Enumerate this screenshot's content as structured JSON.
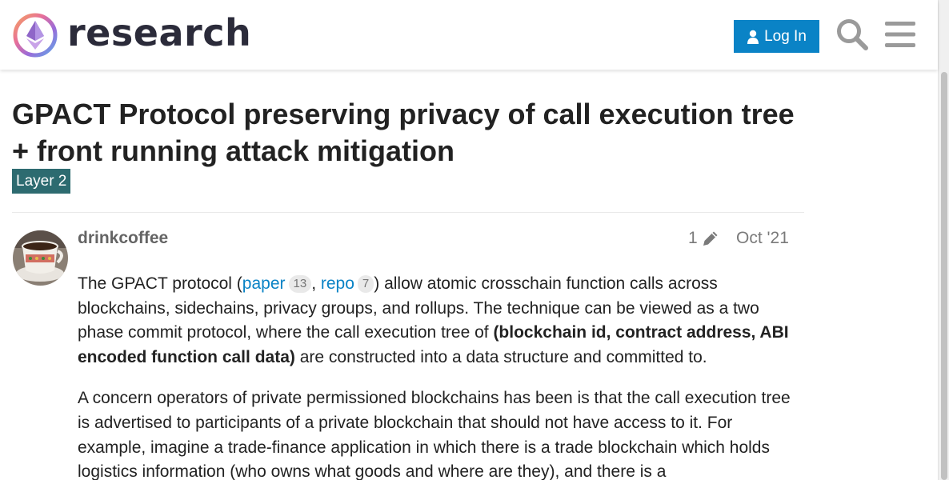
{
  "header": {
    "site_name": "research",
    "login_label": "Log In",
    "icons": [
      "user-icon",
      "search-icon",
      "hamburger-menu-icon"
    ],
    "accent_color": "#0a83c6"
  },
  "topic": {
    "title": "GPACT Protocol preserving privacy of call execution tree + front running attack mitigation",
    "category": "Layer 2",
    "category_color": "#2d6b70"
  },
  "post": {
    "username": "drinkcoffee",
    "edit_count": "1",
    "date": "Oct '21",
    "p1": {
      "prefix": "The GPACT protocol (",
      "link1": "paper",
      "link1_count": "13",
      "sep": ", ",
      "link2": "repo",
      "link2_count": "7",
      "mid": ") allow atomic crosschain function calls across blockchains, sidechains, privacy groups, and rollups. The technique can be viewed as a two phase commit protocol, where the call execution tree of ",
      "bold": "(blockchain id, contract address, ABI encoded function call data)",
      "suffix": " are constructed into a data structure and committed to."
    },
    "p2": "A concern operators of private permissioned blockchains has been is that the call execution tree is advertised to participants of a private blockchain that should not have access to it. For example, imagine a trade-finance application in which there is a trade blockchain which holds logistics information (who owns what goods and where are they), and there is a"
  }
}
